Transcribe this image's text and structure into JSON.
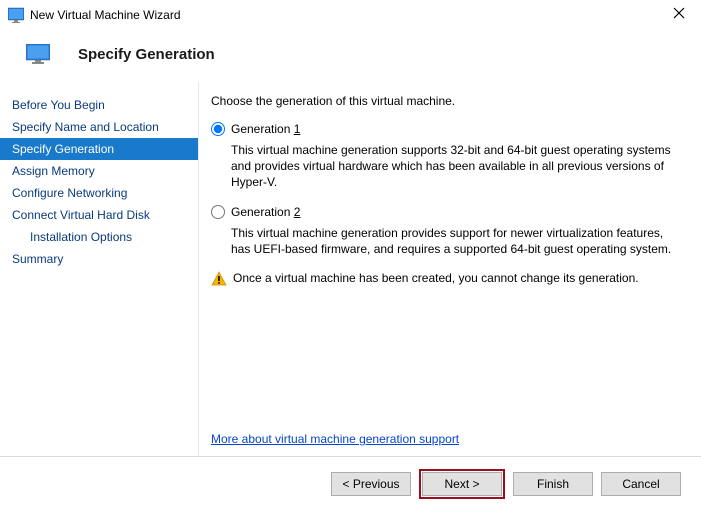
{
  "window": {
    "title": "New Virtual Machine Wizard"
  },
  "header": {
    "title": "Specify Generation"
  },
  "sidebar": {
    "items": [
      {
        "label": "Before You Begin"
      },
      {
        "label": "Specify Name and Location"
      },
      {
        "label": "Specify Generation"
      },
      {
        "label": "Assign Memory"
      },
      {
        "label": "Configure Networking"
      },
      {
        "label": "Connect Virtual Hard Disk"
      },
      {
        "label": "Installation Options"
      },
      {
        "label": "Summary"
      }
    ]
  },
  "main": {
    "instruction": "Choose the generation of this virtual machine.",
    "gen1": {
      "label_prefix": "Generation ",
      "hotkey": "1",
      "desc": "This virtual machine generation supports 32-bit and 64-bit guest operating systems and provides virtual hardware which has been available in all previous versions of Hyper-V."
    },
    "gen2": {
      "label_prefix": "Generation ",
      "hotkey": "2",
      "desc": "This virtual machine generation provides support for newer virtualization features, has UEFI-based firmware, and requires a supported 64-bit guest operating system."
    },
    "warning": "Once a virtual machine has been created, you cannot change its generation.",
    "link": "More about virtual machine generation support"
  },
  "footer": {
    "previous": "< Previous",
    "next": "Next >",
    "finish": "Finish",
    "cancel": "Cancel"
  }
}
